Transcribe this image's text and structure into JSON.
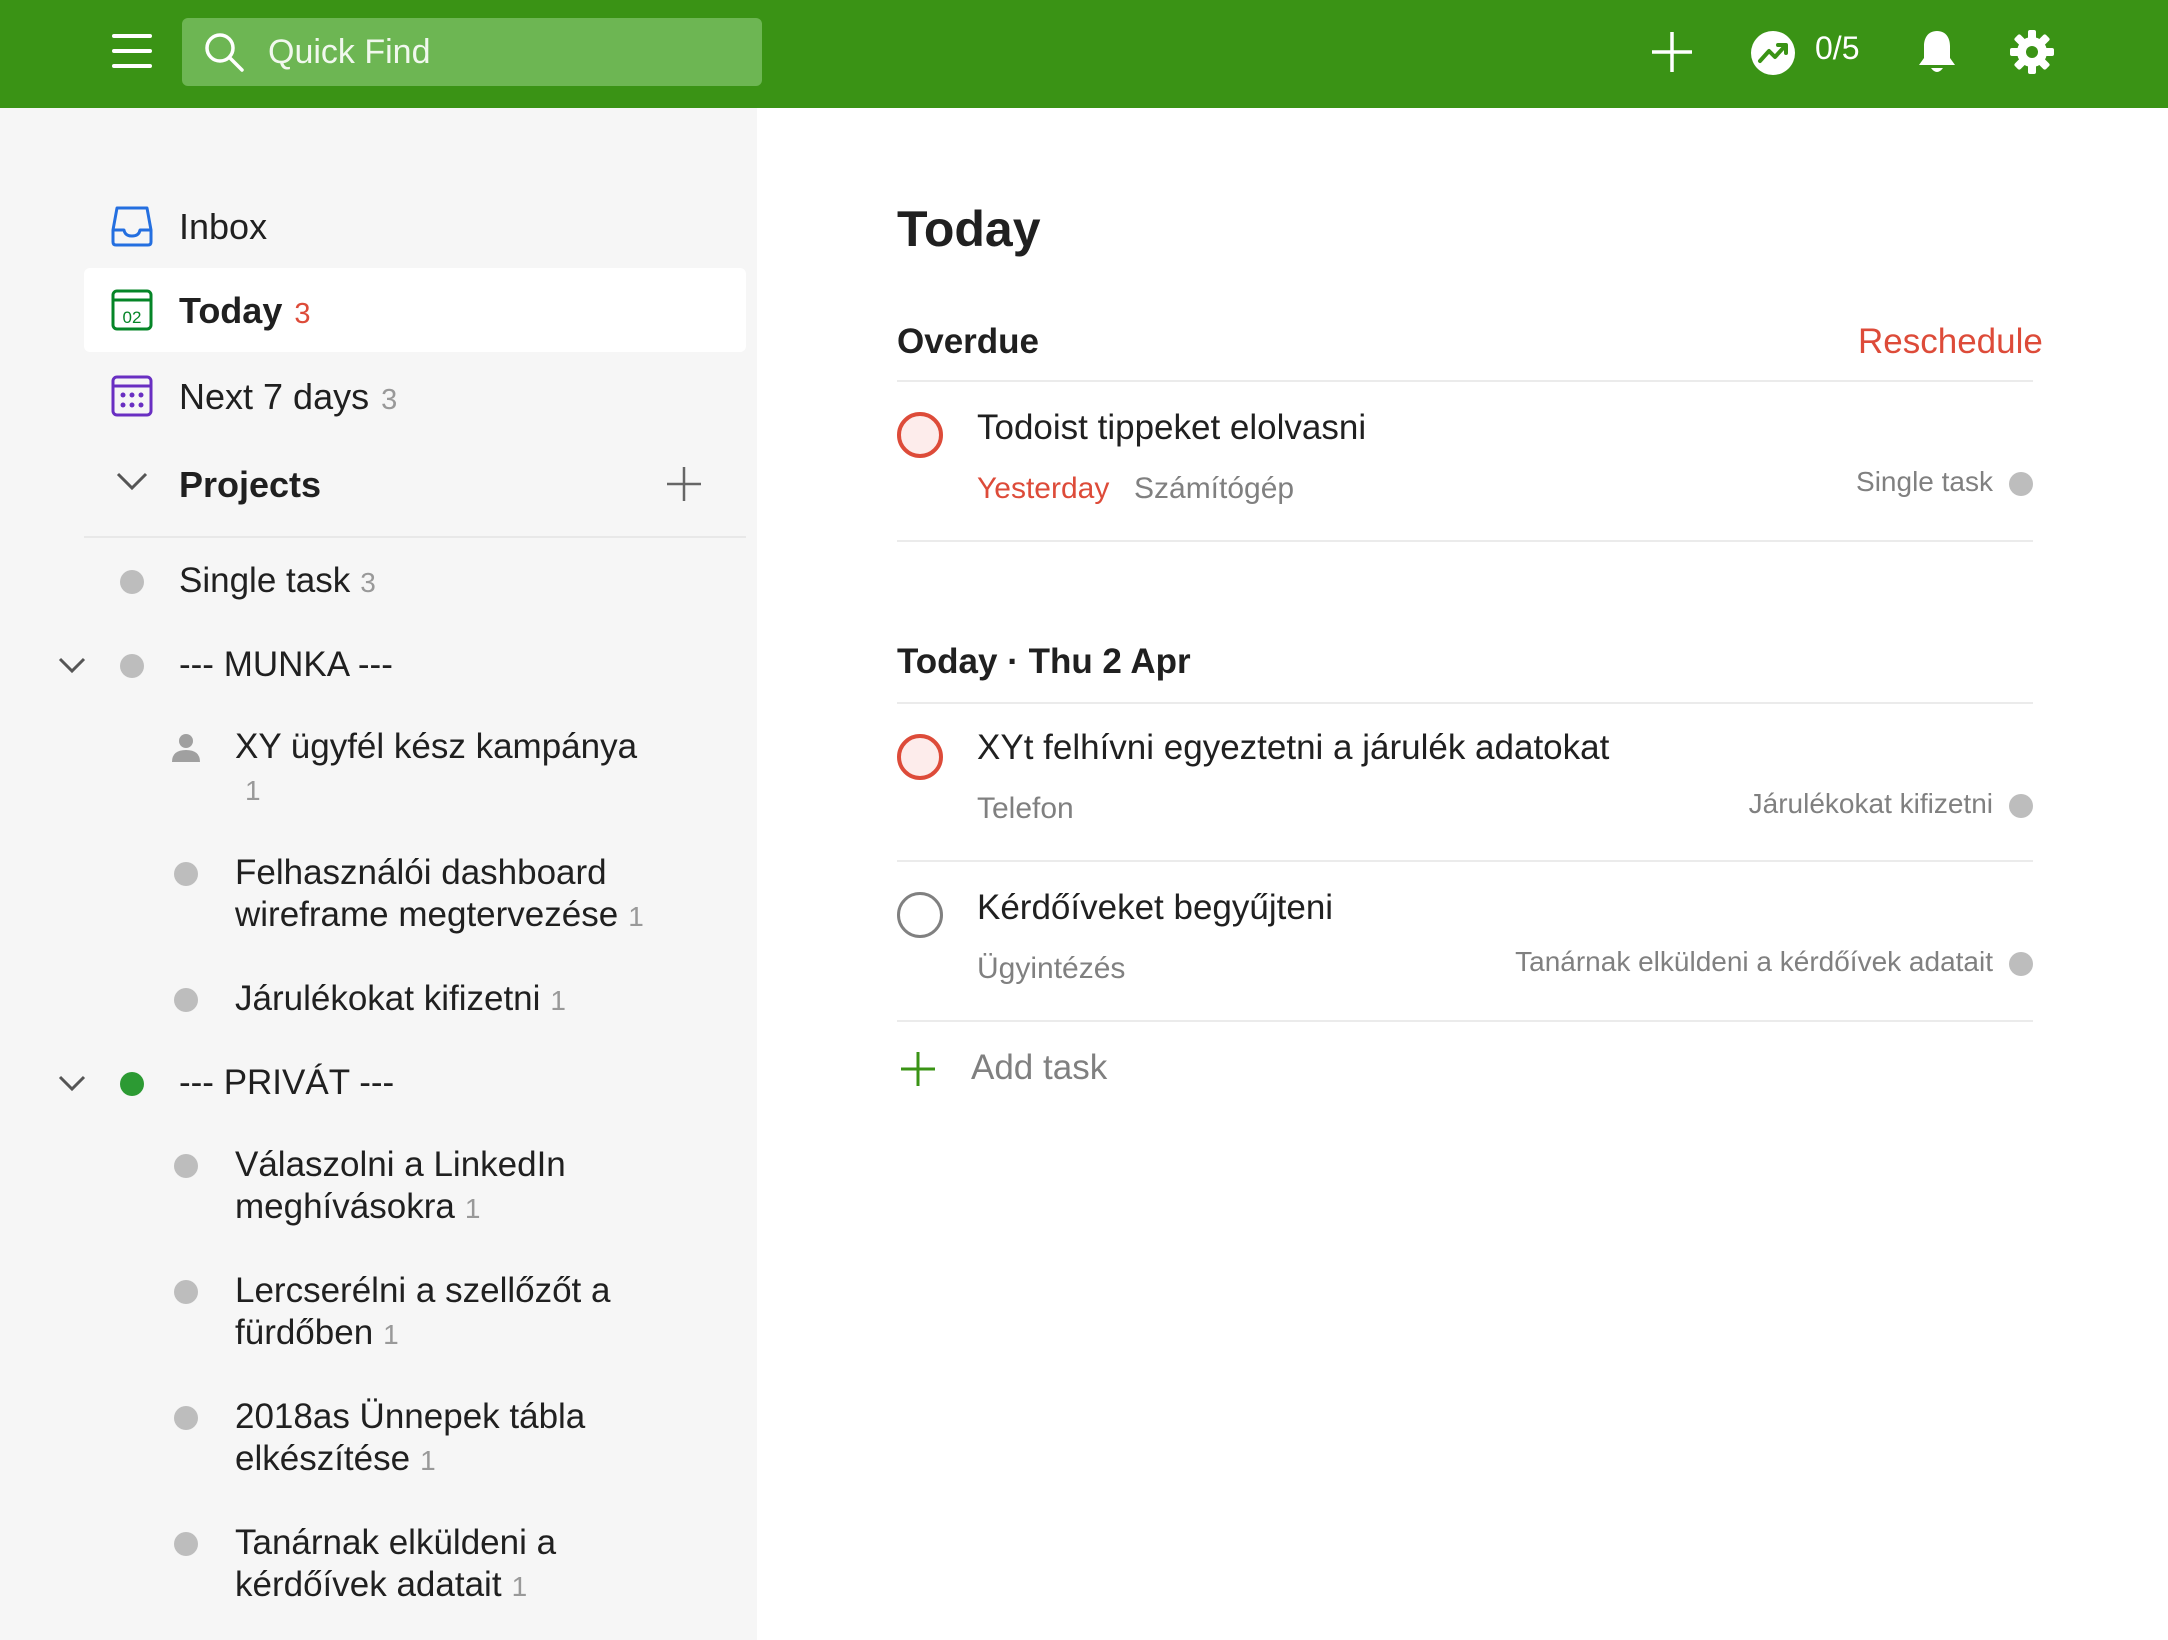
{
  "colors": {
    "brand_green": "#3a9315",
    "overdue_red": "#dd4b39",
    "private_dot": "#2c9a33",
    "default_dot": "#bdbdbd"
  },
  "topbar": {
    "search_placeholder": "Quick Find",
    "karma": "0/5",
    "icons": [
      "menu-icon",
      "search-icon",
      "plus-icon",
      "productivity-icon",
      "bell-icon",
      "gear-icon"
    ]
  },
  "sidebar": {
    "nav": [
      {
        "label": "Inbox",
        "count": "",
        "icon": "inbox-icon"
      },
      {
        "label": "Today",
        "count": "3",
        "icon": "calendar-today-icon"
      },
      {
        "label": "Next 7 days",
        "count": "3",
        "icon": "calendar-week-icon"
      }
    ],
    "projects_label": "Projects",
    "projects": [
      {
        "name": "Single task",
        "count": "3"
      },
      {
        "name": "--- MUNKA ---",
        "count": ""
      },
      {
        "name": "XY ügyfél kész kampánya",
        "count": "1"
      },
      {
        "name": "Felhasználói dashboard wireframe megtervezése",
        "count": "1"
      },
      {
        "name": "Járulékokat kifizetni",
        "count": "1"
      },
      {
        "name": "--- PRIVÁT ---",
        "count": ""
      },
      {
        "name": "Válaszolni a LinkedIn meghívásokra",
        "count": "1"
      },
      {
        "name": "Lercserélni a szellőzőt a fürdőben",
        "count": "1"
      },
      {
        "name": "2018as Ünnepek tábla elkészítése",
        "count": "1"
      },
      {
        "name": "Tanárnak elküldeni a kérdőívek adatait",
        "count": "1"
      }
    ]
  },
  "main": {
    "title": "Today",
    "overdue": {
      "heading": "Overdue",
      "action": "Reschedule",
      "tasks": [
        {
          "content": "Todoist tippeket elolvasni",
          "date": "Yesterday",
          "label": "Számítógép",
          "project": "Single task"
        }
      ]
    },
    "today": {
      "heading": "Today · Thu 2 Apr",
      "tasks": [
        {
          "content": "XYt felhívni egyeztetni a járulék adatokat",
          "label": "Telefon",
          "project": "Járulékokat kifizetni"
        },
        {
          "content": "Kérdőíveket begyűjteni",
          "label": "Ügyintézés",
          "project": "Tanárnak elküldeni a kérdőívek adatait"
        }
      ]
    },
    "add_task_label": "Add task"
  }
}
